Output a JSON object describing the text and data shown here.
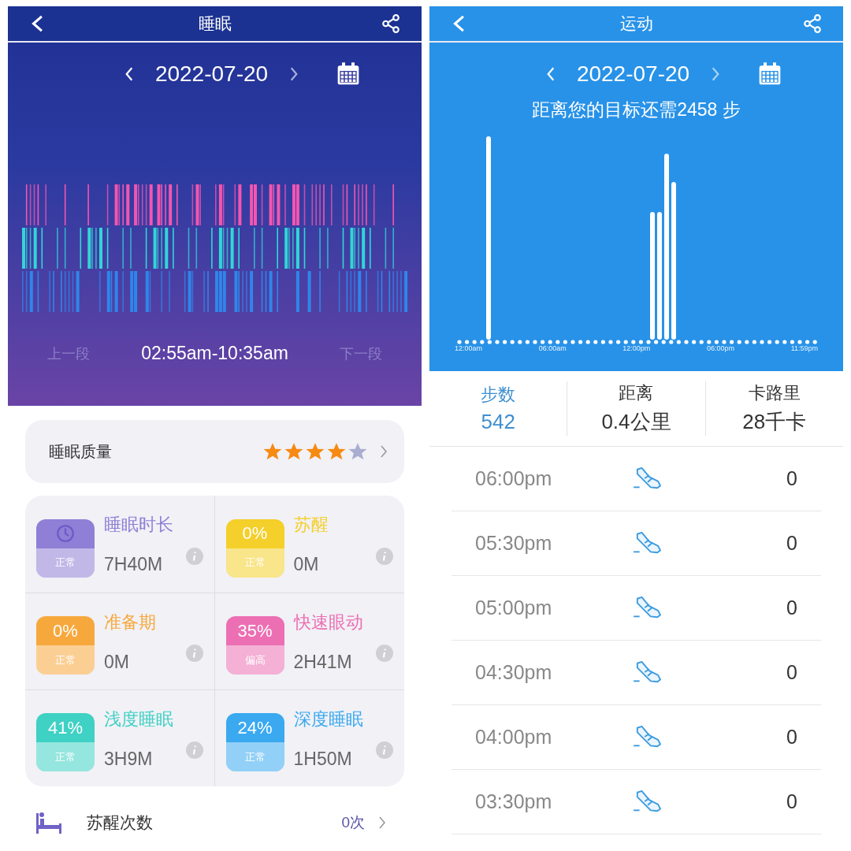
{
  "sleep": {
    "title": "睡眠",
    "date": "2022-07-20",
    "prev_segment": "上一段",
    "time_range": "02:55am-10:35am",
    "next_segment": "下一段",
    "quality": {
      "label": "睡眠质量",
      "stars": 4
    },
    "metrics": [
      {
        "kind": "clock",
        "color": "#8f7fd6",
        "title": "睡眠时长",
        "status": "正常",
        "value": "7H40M"
      },
      {
        "kind": "percent",
        "color": "#f5cf2a",
        "percent": "0%",
        "title": "苏醒",
        "status": "正常",
        "value": "0M"
      },
      {
        "kind": "percent",
        "color": "#f7a83c",
        "percent": "0%",
        "title": "准备期",
        "status": "正常",
        "value": "0M"
      },
      {
        "kind": "percent",
        "color": "#ec6fb3",
        "percent": "35%",
        "title": "快速眼动",
        "status": "偏高",
        "value": "2H41M"
      },
      {
        "kind": "percent",
        "color": "#3fd1c4",
        "percent": "41%",
        "title": "浅度睡眠",
        "status": "正常",
        "value": "3H9M"
      },
      {
        "kind": "percent",
        "color": "#3aa9f0",
        "percent": "24%",
        "title": "深度睡眠",
        "status": "正常",
        "value": "1H50M"
      }
    ],
    "wake_count": {
      "label": "苏醒次数",
      "value": "0次"
    }
  },
  "activity": {
    "title": "运动",
    "date": "2022-07-20",
    "goal": "距离您的目标还需2458 步",
    "axis_labels": [
      "12:00am",
      "06:00am",
      "12:00pm",
      "06:00pm",
      "11:59pm"
    ],
    "stats": [
      {
        "label": "步数",
        "value": "542",
        "selected": true
      },
      {
        "label": "距离",
        "value": "0.4公里",
        "selected": false
      },
      {
        "label": "卡路里",
        "value": "28千卡",
        "selected": false
      }
    ],
    "rows": [
      {
        "time": "06:00pm",
        "steps": "0"
      },
      {
        "time": "05:30pm",
        "steps": "0"
      },
      {
        "time": "05:00pm",
        "steps": "0"
      },
      {
        "time": "04:30pm",
        "steps": "0"
      },
      {
        "time": "04:00pm",
        "steps": "0"
      },
      {
        "time": "03:30pm",
        "steps": "0"
      }
    ]
  }
}
